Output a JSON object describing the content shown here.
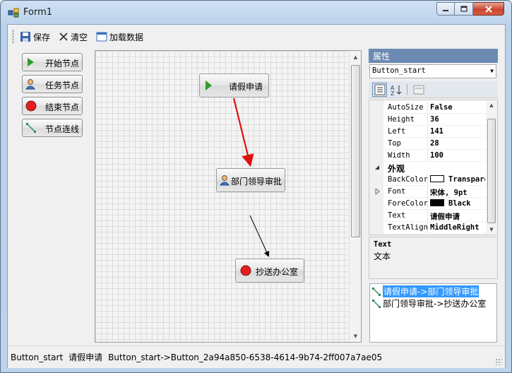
{
  "window": {
    "title": "Form1"
  },
  "toolbar": {
    "save_label": "保存",
    "clear_label": "清空",
    "load_label": "加载数据"
  },
  "node_buttons": [
    {
      "label": "开始节点",
      "icon": "play-triangle-icon"
    },
    {
      "label": "任务节点",
      "icon": "user-icon"
    },
    {
      "label": "结束节点",
      "icon": "stop-circle-icon"
    },
    {
      "label": "节点连线",
      "icon": "connector-line-icon"
    }
  ],
  "canvas": {
    "nodes": [
      {
        "label": "请假申请",
        "kind": "start"
      },
      {
        "label": "部门领导审批",
        "kind": "task"
      },
      {
        "label": "抄送办公室",
        "kind": "end"
      }
    ],
    "colors": {
      "selected_edge": "#e01010",
      "edge": "#000000"
    }
  },
  "properties": {
    "header": "属性",
    "selected_object": "Button_start",
    "rows": [
      {
        "name": "AutoSize",
        "value": "False"
      },
      {
        "name": "Height",
        "value": "36"
      },
      {
        "name": "Left",
        "value": "141"
      },
      {
        "name": "Top",
        "value": "28"
      },
      {
        "name": "Width",
        "value": "100"
      }
    ],
    "category": "外观",
    "appearance_rows": [
      {
        "name": "BackColor",
        "value": "Transparent",
        "swatch": "#ffffff"
      },
      {
        "name": "Font",
        "value": "宋体, 9pt"
      },
      {
        "name": "ForeColor",
        "value": "Black",
        "swatch": "#000000"
      },
      {
        "name": "Text",
        "value": "请假申请"
      },
      {
        "name": "TextAlign",
        "value": "MiddleRight"
      }
    ],
    "description_title": "Text",
    "description_text": "文本"
  },
  "connections": [
    {
      "label": "请假申请->部门领导审批",
      "selected": true
    },
    {
      "label": "部门领导审批->抄送办公室",
      "selected": false
    }
  ],
  "status_bar": {
    "item1": "Button_start",
    "item2": "请假申请",
    "item3": "Button_start->Button_2a94a850-6538-4614-9b74-2ff007a7ae05"
  }
}
